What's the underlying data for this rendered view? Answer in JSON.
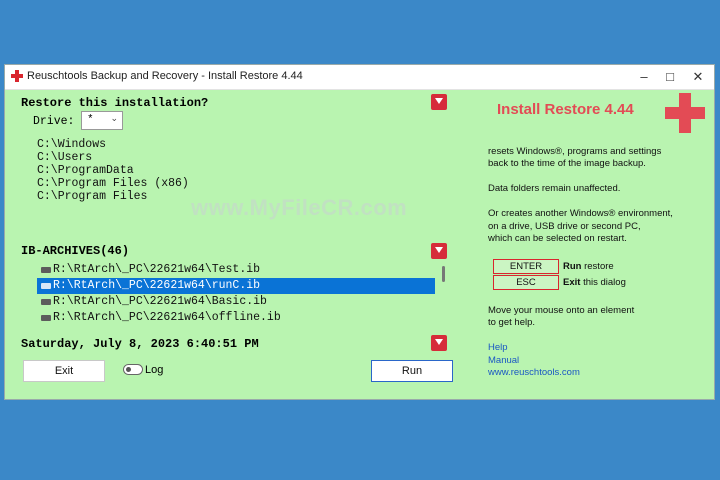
{
  "window": {
    "title": "Reuschtools Backup and Recovery - Install Restore 4.44"
  },
  "restore": {
    "header": "Restore this installation?",
    "drive_label": "Drive:",
    "drive_value": "*",
    "paths": [
      "C:\\Windows",
      "C:\\Users",
      "C:\\ProgramData",
      "C:\\Program Files (x86)",
      "C:\\Program Files"
    ]
  },
  "watermark": "www.MyFileCR.com",
  "archives": {
    "header": "IB-ARCHIVES(46)",
    "items": [
      "R:\\RtArch\\_PC\\22621w64\\Test.ib",
      "R:\\RtArch\\_PC\\22621w64\\runC.ib",
      "R:\\RtArch\\_PC\\22621w64\\Basic.ib",
      "R:\\RtArch\\_PC\\22621w64\\offline.ib"
    ],
    "selected_index": 1
  },
  "datetime": "Saturday, July 8, 2023  6:40:51 PM",
  "buttons": {
    "exit": "Exit",
    "log": "Log",
    "run": "Run"
  },
  "right": {
    "brand": "Install Restore 4.44",
    "desc1": [
      "resets Windows®, programs and settings",
      "back to the time of the image backup."
    ],
    "desc2": "Data folders remain unaffected.",
    "desc3": [
      "Or creates another Windows® environment,",
      "on a drive, USB drive or second PC,",
      "which can be selected on restart."
    ],
    "keys": [
      {
        "key": "ENTER",
        "action": "Run",
        "rest": " restore"
      },
      {
        "key": "ESC",
        "action": "Exit",
        "rest": " this dialog"
      }
    ],
    "hint": [
      "Move your mouse onto an element",
      "to get help."
    ],
    "links": [
      "Help",
      "Manual",
      "www.reuschtools.com"
    ]
  },
  "colors": {
    "background": "#3b88c8",
    "panel": "#b9f4b0",
    "accent_red": "#d62c3a",
    "brand_red": "#e34b55",
    "selection": "#0a73d6",
    "link": "#1a57c4"
  }
}
